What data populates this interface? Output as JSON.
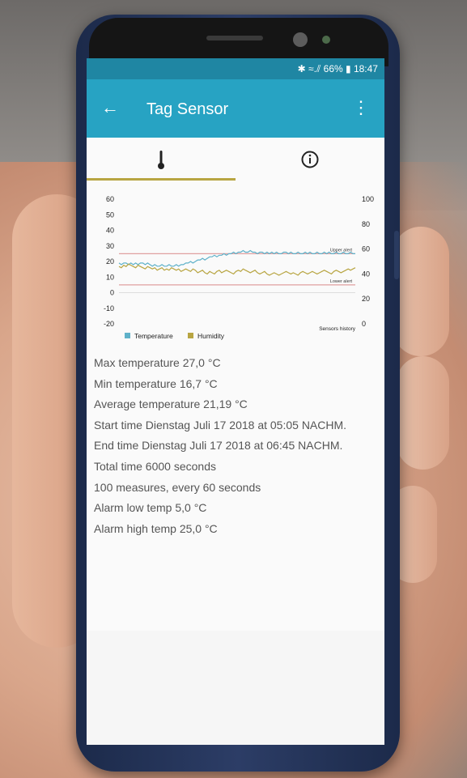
{
  "status_bar": {
    "text": "✱ ≈.⫽ 66% ▮ 18:47"
  },
  "app_bar": {
    "title": "Tag Sensor",
    "back_icon": "arrow-left-icon",
    "more_icon": "more-vert-icon"
  },
  "tabs": [
    {
      "icon": "thermometer-icon",
      "selected": true
    },
    {
      "icon": "info-icon",
      "selected": false
    }
  ],
  "colors": {
    "appbar": "#27a3c3",
    "statusbar": "#1f86a3",
    "tab_indicator": "#b8a542",
    "temperature": "#5fb1c9",
    "humidity": "#b8a542",
    "alert_line": "#e0a0a0"
  },
  "chart_data": {
    "type": "line",
    "y_left_ticks": [
      "60",
      "50",
      "40",
      "30",
      "20",
      "10",
      "0",
      "-10",
      "-20"
    ],
    "y_right_ticks": [
      "100",
      "80",
      "60",
      "40",
      "20",
      "0"
    ],
    "ylim_left": [
      -20,
      60
    ],
    "ylim_right": [
      0,
      100
    ],
    "legend": [
      "Temperature",
      "Humidity"
    ],
    "annotations": {
      "upper_alert": "Upper alert",
      "lower_alert": "Lower alert",
      "description": "Sensors history"
    },
    "upper_alert_value": 25,
    "lower_alert_value": 5,
    "series": [
      {
        "name": "Temperature",
        "axis": "left",
        "values": [
          19,
          18,
          19,
          19,
          18,
          19,
          18,
          19,
          18,
          19,
          19,
          18,
          19,
          18,
          17,
          18,
          17,
          17,
          18,
          17,
          17,
          18,
          17,
          17,
          18,
          17,
          18,
          18,
          19,
          19,
          20,
          19,
          20,
          21,
          21,
          22,
          21,
          22,
          23,
          23,
          24,
          23,
          24,
          24,
          25,
          24,
          25,
          25,
          26,
          25,
          26,
          26,
          27,
          26,
          26,
          27,
          26,
          26,
          25,
          26,
          26,
          25,
          26,
          25,
          26,
          25,
          26,
          25,
          25,
          26,
          26,
          25,
          26,
          25,
          25,
          26,
          25,
          25,
          26,
          25,
          26,
          25,
          25,
          26,
          25,
          25,
          26,
          25,
          26,
          25,
          25,
          26,
          25,
          25,
          26,
          25,
          25,
          26,
          25,
          25
        ]
      },
      {
        "name": "Humidity",
        "axis": "right",
        "values": [
          46,
          45,
          47,
          46,
          48,
          47,
          46,
          45,
          47,
          46,
          45,
          44,
          46,
          45,
          44,
          45,
          43,
          44,
          45,
          43,
          44,
          43,
          45,
          44,
          43,
          44,
          42,
          43,
          44,
          43,
          42,
          44,
          43,
          41,
          42,
          43,
          41,
          40,
          42,
          41,
          40,
          42,
          43,
          41,
          42,
          43,
          42,
          41,
          40,
          42,
          43,
          42,
          44,
          43,
          42,
          41,
          42,
          43,
          41,
          40,
          41,
          42,
          40,
          39,
          40,
          41,
          40,
          39,
          40,
          41,
          42,
          41,
          40,
          41,
          40,
          39,
          41,
          42,
          41,
          40,
          41,
          42,
          41,
          40,
          41,
          42,
          43,
          42,
          41,
          40,
          42,
          43,
          42,
          41,
          42,
          43,
          44,
          43,
          44,
          45
        ]
      }
    ]
  },
  "info_lines": {
    "max_temp": "Max temperature 27,0 °C",
    "min_temp": "Min temperature 16,7 °C",
    "avg_temp": "Average temperature 21,19 °C",
    "start_time": "Start time Dienstag Juli 17 2018 at 05:05 NACHM.",
    "end_time": "End time Dienstag Juli 17 2018 at 06:45 NACHM.",
    "total_time": "Total time 6000 seconds",
    "measures": "100 measures, every 60 seconds",
    "alarm_low": "Alarm low temp 5,0 °C",
    "alarm_high": "Alarm high temp 25,0 °C"
  }
}
